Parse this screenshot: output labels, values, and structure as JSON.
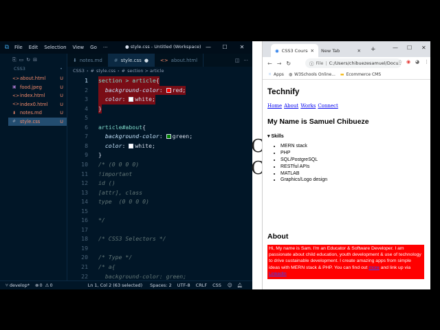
{
  "vscode": {
    "menus": [
      "File",
      "Edit",
      "Selection",
      "View",
      "Go"
    ],
    "more": "···",
    "window_title": "● style.css - Untitled (Workspace) - ...",
    "window_buttons": {
      "min": "—",
      "max": "☐",
      "close": "✕"
    },
    "explorer": {
      "folder": "CSS3",
      "files": [
        {
          "name": "about.html",
          "status": "U",
          "type": "html",
          "color": "#f78c6c"
        },
        {
          "name": "food.jpeg",
          "status": "U",
          "type": "image",
          "color": "#f78c6c"
        },
        {
          "name": "index.html",
          "status": "U",
          "type": "html",
          "color": "#f78c6c"
        },
        {
          "name": "index0.html",
          "status": "U",
          "type": "html",
          "color": "#f78c6c"
        },
        {
          "name": "notes.md",
          "status": "U",
          "type": "md",
          "color": "#f78c6c"
        },
        {
          "name": "style.css",
          "status": "U",
          "type": "css",
          "color": "#f78c6c"
        }
      ]
    },
    "tabs": [
      {
        "label": "notes.md",
        "active": false
      },
      {
        "label": "style.css",
        "active": true
      },
      {
        "label": "about.html",
        "active": false
      }
    ],
    "breadcrumb": [
      "CSS3",
      "#",
      "style.css",
      "#",
      "section > article"
    ],
    "status": {
      "branch": "develop*",
      "errors": "0",
      "warnings": "0",
      "position": "Ln 1, Col 2 (63 selected)",
      "spaces": "Spaces: 2",
      "encoding": "UTF-8",
      "eol": "CRLF",
      "language": "CSS"
    }
  },
  "code_lines": [
    {
      "n": "1",
      "t": "section > article{"
    },
    {
      "n": "2",
      "t": "  background-color: red;"
    },
    {
      "n": "3",
      "t": "  color: white;"
    },
    {
      "n": "4",
      "t": "}"
    },
    {
      "n": "5",
      "t": ""
    },
    {
      "n": "6",
      "t": "article#about{"
    },
    {
      "n": "7",
      "t": "  background-color: green;"
    },
    {
      "n": "8",
      "t": "  color: white;"
    },
    {
      "n": "9",
      "t": "}"
    },
    {
      "n": "10",
      "t": "/* (0 0 0 0)"
    },
    {
      "n": "11",
      "t": "!important"
    },
    {
      "n": "12",
      "t": "id ()"
    },
    {
      "n": "13",
      "t": "[attr], class"
    },
    {
      "n": "14",
      "t": "type  (0 0 0 0)"
    },
    {
      "n": "15",
      "t": ""
    },
    {
      "n": "16",
      "t": "*/"
    },
    {
      "n": "17",
      "t": ""
    },
    {
      "n": "18",
      "t": "/* CSS3 Selectors */"
    },
    {
      "n": "19",
      "t": ""
    },
    {
      "n": "20",
      "t": "/* Type */"
    },
    {
      "n": "21",
      "t": "/* a{"
    },
    {
      "n": "22",
      "t": "  background-color: green;"
    }
  ],
  "behind_text": [
    "C",
    "C"
  ],
  "chrome": {
    "tabs": [
      {
        "label": "CSS3 Course fro",
        "active": true
      },
      {
        "label": "New Tab",
        "active": false
      }
    ],
    "new_tab": "+",
    "url_prefix": "File",
    "url": "C:/Users/chibuezesamuel/Docu...",
    "bookmarks": [
      "Apps",
      "W3Schools Online...",
      "Ecommerce CMS"
    ],
    "window_buttons": {
      "min": "—",
      "max": "☐",
      "close": "✕"
    }
  },
  "page": {
    "site_title": "Technify",
    "nav": [
      "Home",
      "About",
      "Works",
      "Connect"
    ],
    "heading": "My Name is Samuel Chibueze",
    "skills_summary": "Skills",
    "skills": [
      "MERN stack",
      "PHP",
      "SQL/PostgreSQL",
      "RESTful APIs",
      "MATLAB",
      "Graphics/Logo design"
    ],
    "about_heading": "About",
    "about_text": "Hi, My name is Sam. I'm an Educator & Software Developer. I am passionate about child education, youth development & use of technology to drive sustainable development. I create amazing apps from simple ideas with MERN stack & PHP. You can find out",
    "about_link1": "more",
    "about_link_mid": "and link up via",
    "about_link2": "LinkedIn"
  },
  "colors": {
    "editor_bg": "#011627",
    "selection": "#7a0d16",
    "about_bg": "#ff0000",
    "link": "#0000ee"
  }
}
